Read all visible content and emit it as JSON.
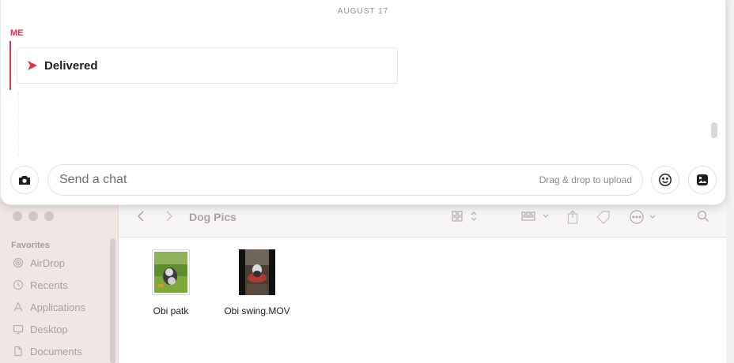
{
  "chat": {
    "date_divider": "AUGUST 17",
    "sender_label": "ME",
    "message_status": "Delivered",
    "composer": {
      "placeholder": "Send a chat",
      "drop_hint": "Drag & drop to upload"
    },
    "accent_color": "#e0334a"
  },
  "finder": {
    "folder_title": "Dog Pics",
    "sidebar": {
      "heading": "Favorites",
      "items": [
        {
          "label": "AirDrop",
          "icon": "airdrop-icon"
        },
        {
          "label": "Recents",
          "icon": "clock-icon"
        },
        {
          "label": "Applications",
          "icon": "applications-icon"
        },
        {
          "label": "Desktop",
          "icon": "desktop-icon"
        },
        {
          "label": "Documents",
          "icon": "document-icon"
        }
      ]
    },
    "files": [
      {
        "name": "Obi patk",
        "kind": "image"
      },
      {
        "name": "Obi swing.MOV",
        "kind": "video"
      }
    ]
  }
}
